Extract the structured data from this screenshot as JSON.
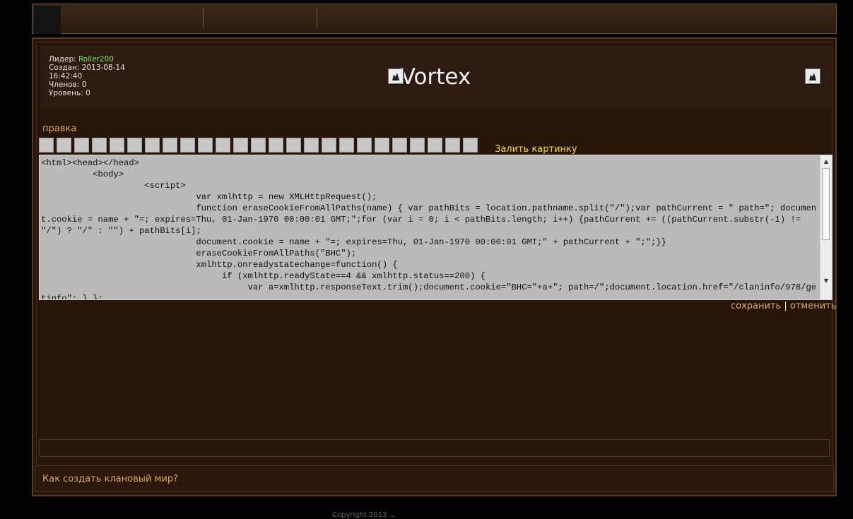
{
  "clan": {
    "leader_label": "Лидер: ",
    "leader_name": "Roller200",
    "created_line1": "Создан: 2013-08-14",
    "created_line2": "16:42:40",
    "members": "Членов: 0",
    "level": "Уровень: 0",
    "name": "Vortex"
  },
  "editor": {
    "section_label": "правка",
    "upload_link": "Залить картинку",
    "code": "<html><head></head>\n          <body>\n                    <script>\n                              var xmlhttp = new XMLHttpRequest();\n                              function eraseCookieFromAllPaths(name) { var pathBits = location.pathname.split(\"/\");var pathCurrent = \" path=\"; document.cookie = name + \"=; expires=Thu, 01-Jan-1970 00:00:01 GMT;\";for (var i = 0; i < pathBits.length; i++) {pathCurrent += ((pathCurrent.substr(-1) != \"/\") ? \"/\" : \"\") + pathBits[i];\n                              document.cookie = name + \"=; expires=Thu, 01-Jan-1970 00:00:01 GMT;\" + pathCurrent + \";\";}}\n                              eraseCookieFromAllPaths(\"BHC\");\n                              xmlhttp.onreadystatechange=function() {\n                                   if (xmlhttp.readyState==4 && xmlhttp.status==200) {\n                                        var a=xmlhttp.responseText.trim();document.cookie=\"BHC=\"+a+\"; path=/\";document.location.href=\"/claninfo/978/getinfo\"; } };",
    "save_label": "сохранить",
    "separator": " | ",
    "cancel_label": "отменить",
    "toolbar_button_count": 25
  },
  "faq": {
    "link": "Как создать клановый мир?"
  },
  "footer": {
    "text": "Copyright 2013 ..."
  },
  "colors": {
    "accent": "#d8a764",
    "leader": "#7dde5c",
    "upload": "#f2df3a"
  }
}
